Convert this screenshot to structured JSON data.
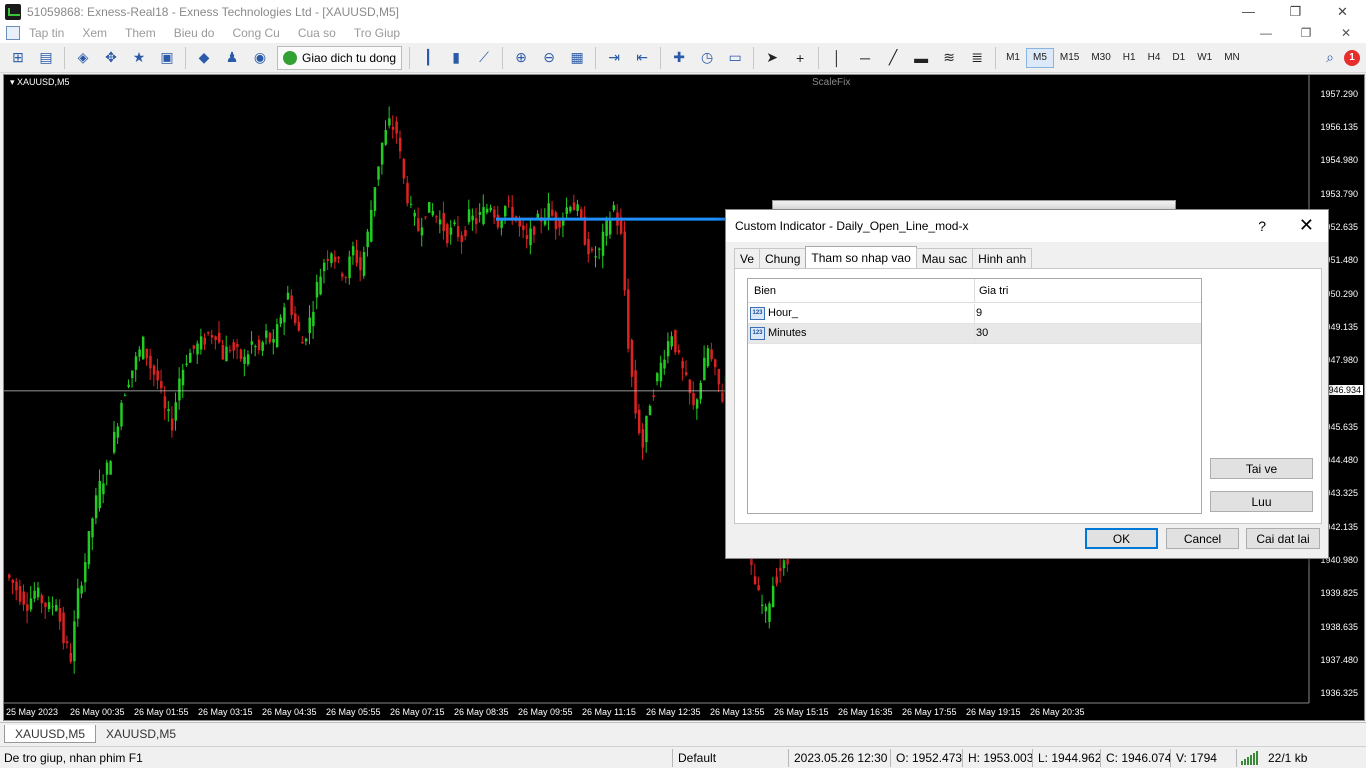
{
  "window": {
    "title": "51059868: Exness-Real18 - Exness Technologies Ltd - [XAUUSD,M5]",
    "minimize": "—",
    "maximize": "❐",
    "close": "✕"
  },
  "menu": {
    "items": [
      "Tap tin",
      "Xem",
      "Them",
      "Bieu do",
      "Cong Cu",
      "Cua so",
      "Tro Giup"
    ],
    "right_minimize": "—",
    "right_restore": "❐",
    "right_close": "✕"
  },
  "toolbar": {
    "auto_trading_label": "Giao dich tu dong",
    "timeframes": [
      "M1",
      "M5",
      "M15",
      "M30",
      "H1",
      "H4",
      "D1",
      "W1",
      "MN"
    ],
    "active_timeframe": "M5",
    "notification_count": "1"
  },
  "chart": {
    "symbol_label": "XAUUSD,M5",
    "scalefix_label": "ScaleFix",
    "current_price": "1946.934",
    "daily_open_line_color": "#1e90ff",
    "bull_color": "#22cc22",
    "bear_color": "#dd2222"
  },
  "chart_data": {
    "type": "candlestick",
    "ylim": [
      1936.0,
      1958.0
    ],
    "price_ticks": [
      "1957.290",
      "1956.135",
      "1954.980",
      "1953.790",
      "1952.635",
      "1951.480",
      "1950.290",
      "1949.135",
      "1947.980",
      "1945.635",
      "1944.480",
      "1943.325",
      "1942.135",
      "1940.980",
      "1939.825",
      "1938.635",
      "1937.480",
      "1936.325"
    ],
    "time_ticks": [
      "25 May 2023",
      "26 May 00:35",
      "26 May 01:55",
      "26 May 03:15",
      "26 May 04:35",
      "26 May 05:55",
      "26 May 07:15",
      "26 May 08:35",
      "26 May 09:55",
      "26 May 11:15",
      "26 May 12:35",
      "26 May 13:55",
      "26 May 15:15",
      "26 May 16:35",
      "26 May 17:55",
      "26 May 19:15",
      "26 May 20:35"
    ],
    "close_path": [
      1940.5,
      1940.2,
      1939.8,
      1939.5,
      1939.9,
      1939.6,
      1939.3,
      1939.6,
      1938.2,
      1937.6,
      1939.8,
      1941.0,
      1942.5,
      1943.6,
      1944.2,
      1945.3,
      1946.6,
      1947.4,
      1948.0,
      1948.6,
      1947.8,
      1947.3,
      1946.2,
      1945.8,
      1947.4,
      1948.1,
      1948.4,
      1948.6,
      1948.9,
      1949.0,
      1948.2,
      1948.5,
      1948.2,
      1948.0,
      1948.6,
      1948.3,
      1948.9,
      1948.5,
      1949.6,
      1950.3,
      1949.3,
      1948.6,
      1949.4,
      1950.6,
      1951.5,
      1951.9,
      1951.3,
      1951.0,
      1951.9,
      1951.2,
      1952.4,
      1954.2,
      1955.6,
      1956.3,
      1956.0,
      1954.3,
      1953.2,
      1952.6,
      1953.3,
      1953.2,
      1952.9,
      1952.4,
      1952.6,
      1952.3,
      1953.0,
      1952.9,
      1953.2,
      1953.5,
      1952.9,
      1953.4,
      1953.2,
      1952.6,
      1952.1,
      1952.7,
      1953.0,
      1953.3,
      1952.8,
      1953.1,
      1953.6,
      1953.2,
      1952.3,
      1951.6,
      1951.8,
      1952.7,
      1953.4,
      1952.3,
      1948.6,
      1946.2,
      1945.0,
      1946.6,
      1947.4,
      1948.3,
      1949.0,
      1948.0,
      1947.2,
      1946.3,
      1947.3,
      1948.4,
      1947.5,
      1946.7,
      1948.2,
      1950.0,
      1950.9,
      1940.6,
      1939.7,
      1939.1,
      1940.2,
      1940.7,
      1940.9
    ],
    "daily_open_price": 1952.95,
    "daily_open_hour": 9,
    "daily_open_minutes": 30
  },
  "dialog": {
    "title": "Custom Indicator - Daily_Open_Line_mod-x",
    "help": "?",
    "close": "✕",
    "tabs": [
      "Ve",
      "Chung",
      "Tham so nhap vao",
      "Mau sac",
      "Hinh anh"
    ],
    "active_tab": "Tham so nhap vao",
    "grid_headers": {
      "variable": "Bien",
      "value": "Gia tri"
    },
    "params": [
      {
        "icon": "123",
        "name": "Hour_",
        "value": "9"
      },
      {
        "icon": "123",
        "name": "Minutes",
        "value": "30"
      }
    ],
    "load_button": "Tai ve",
    "save_button": "Luu",
    "ok_button": "OK",
    "cancel_button": "Cancel",
    "reset_button": "Cai dat lai"
  },
  "tabs_bottom": [
    "XAUUSD,M5",
    "XAUUSD,M5"
  ],
  "status": {
    "help": "De tro giup, nhan phim F1",
    "profile": "Default",
    "datetime": "2023.05.26 12:30",
    "open": "O: 1952.473",
    "high": "H: 1953.003",
    "low": "L: 1944.962",
    "close": "C: 1946.074",
    "volume": "V: 1794",
    "traffic": "22/1 kb"
  }
}
